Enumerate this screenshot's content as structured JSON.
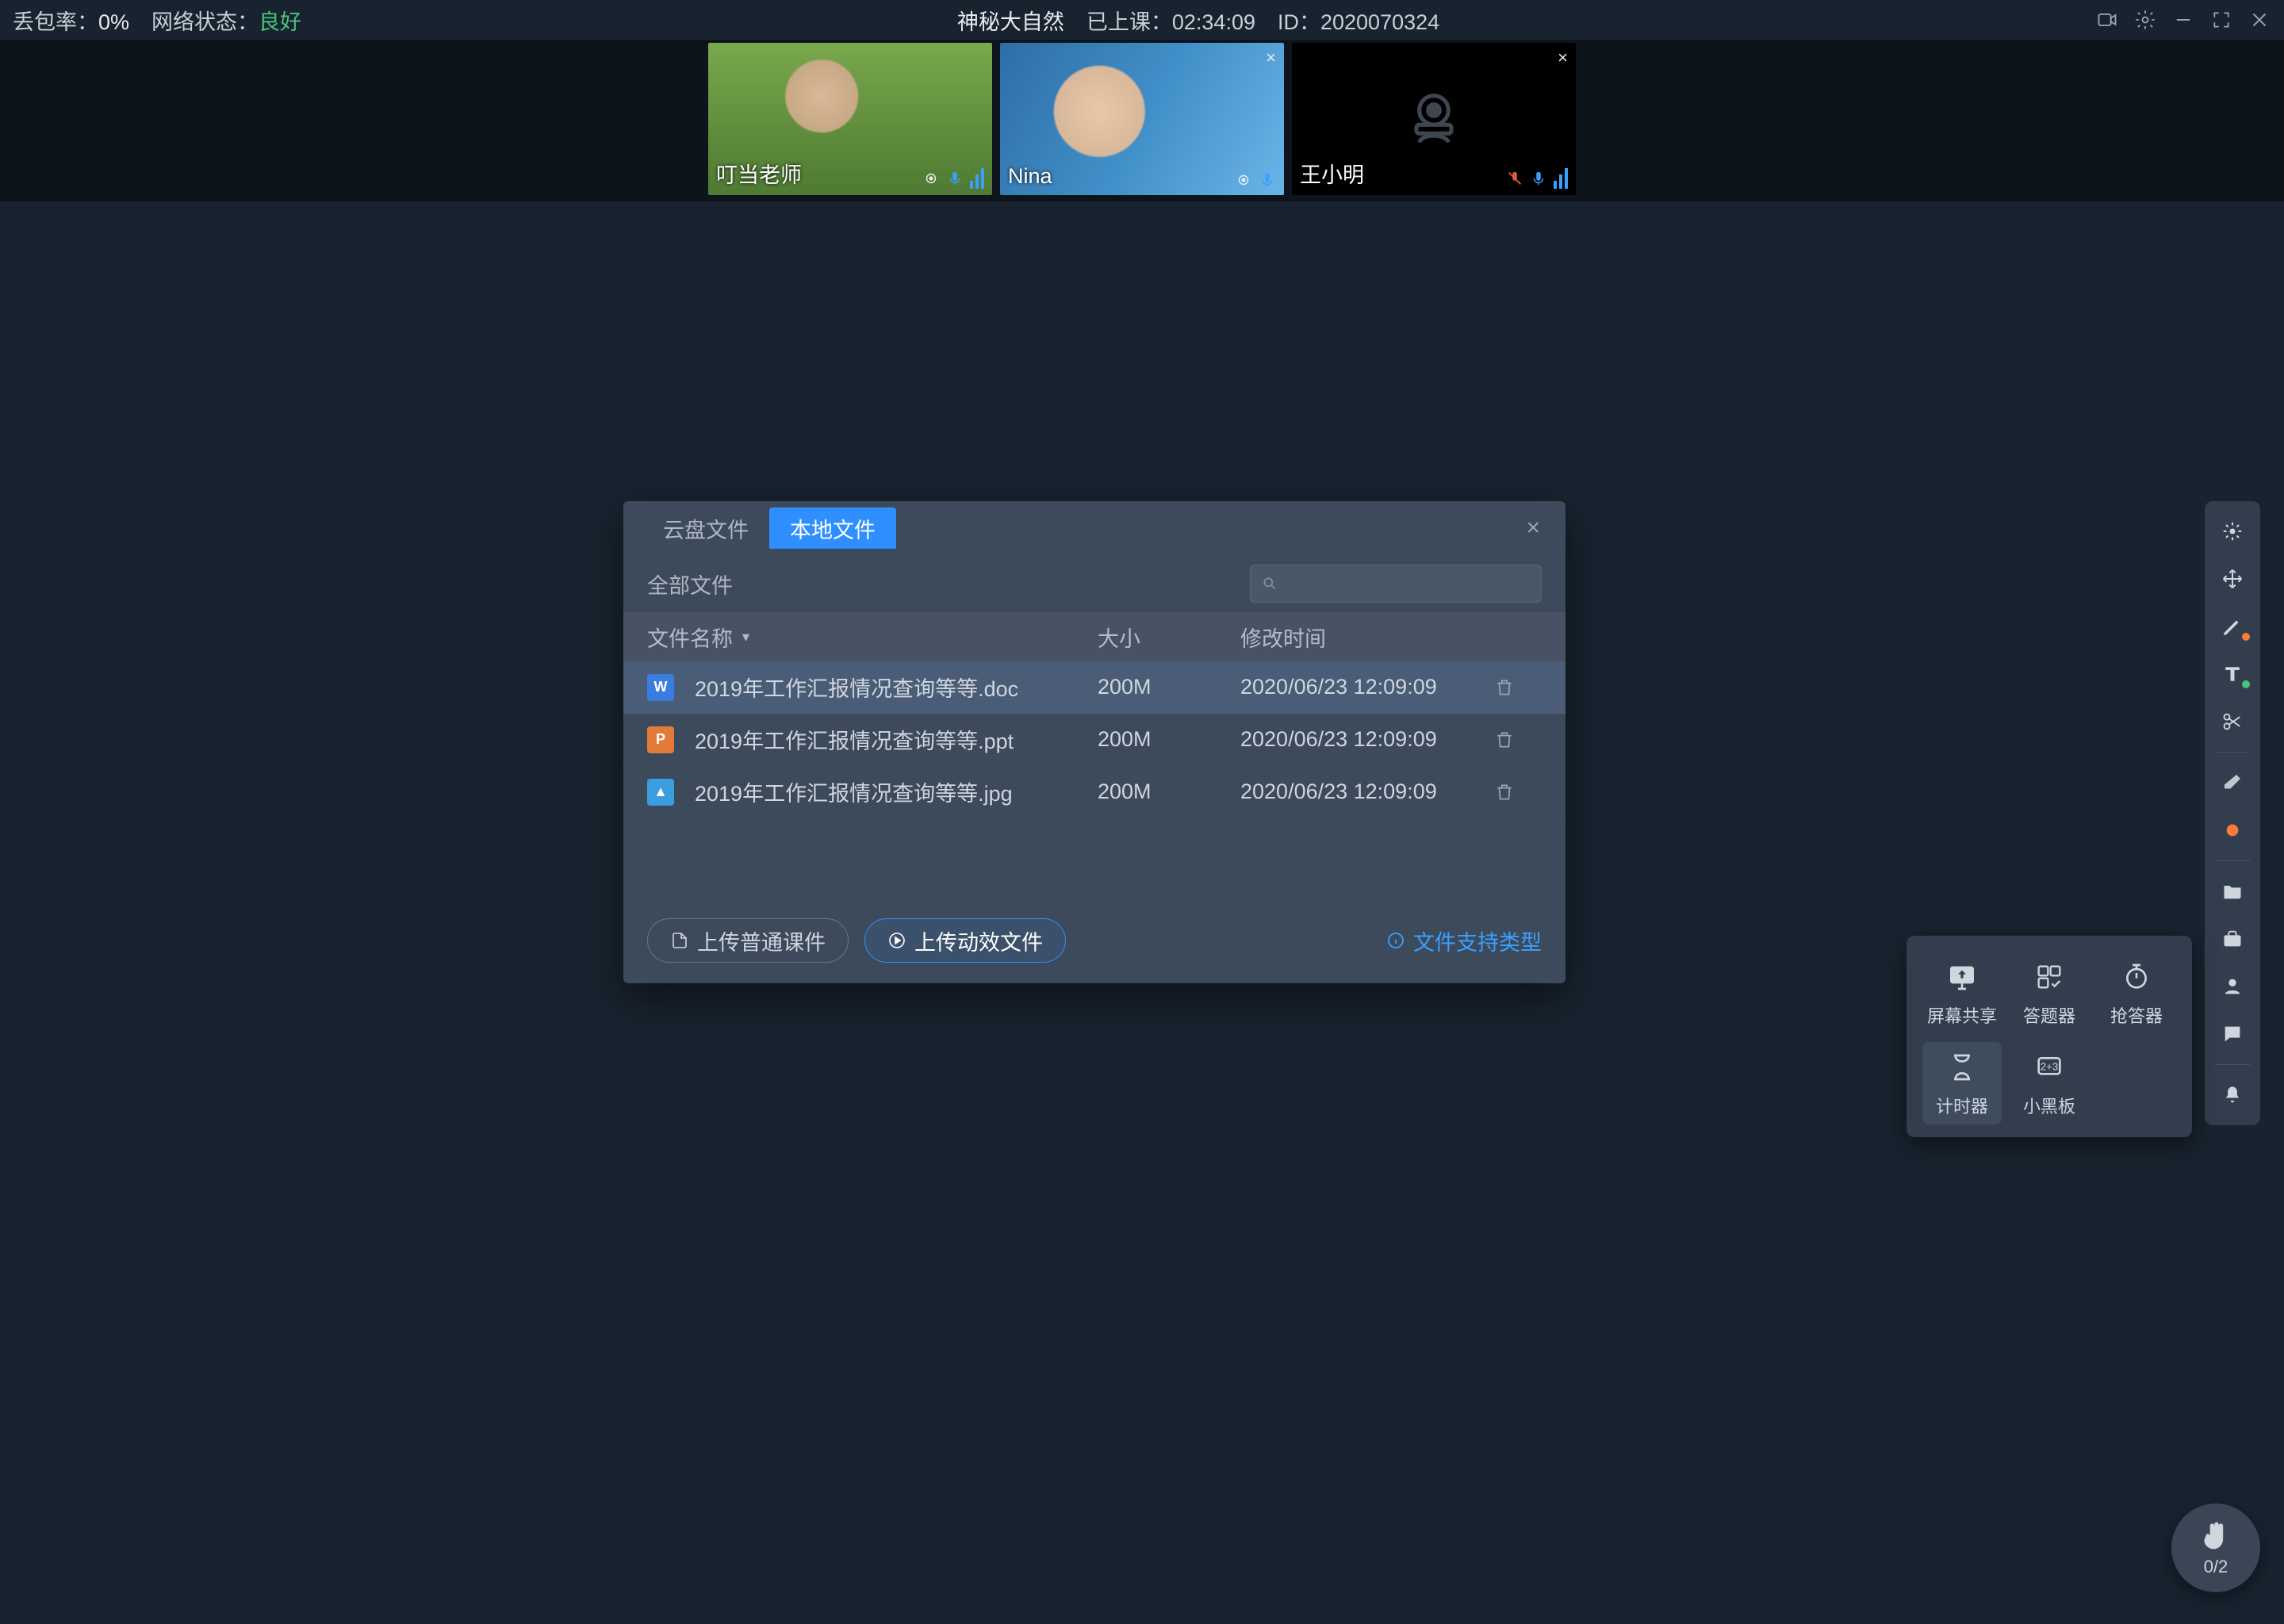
{
  "header": {
    "packetLossLabel": "丢包率：",
    "packetLossValue": "0%",
    "netLabel": "网络状态：",
    "netValue": "良好",
    "title": "神秘大自然",
    "elapsedLabel": "已上课：",
    "elapsedValue": "02:34:09",
    "idLabel": "ID：",
    "idValue": "2020070324"
  },
  "participants": [
    {
      "name": "叮当老师",
      "hasClose": false,
      "cameraOff": false,
      "micMuted": false
    },
    {
      "name": "Nina",
      "hasClose": true,
      "cameraOff": false,
      "micMuted": false
    },
    {
      "name": "王小明",
      "hasClose": true,
      "cameraOff": true,
      "micMuted": true
    }
  ],
  "dialog": {
    "tabs": {
      "cloud": "云盘文件",
      "local": "本地文件"
    },
    "breadcrumb": "全部文件",
    "searchPlaceholder": "",
    "columns": {
      "name": "文件名称",
      "size": "大小",
      "time": "修改时间"
    },
    "files": [
      {
        "icon": "doc",
        "name": "2019年工作汇报情况查询等等.doc",
        "size": "200M",
        "time": "2020/06/23 12:09:09"
      },
      {
        "icon": "ppt",
        "name": "2019年工作汇报情况查询等等.ppt",
        "size": "200M",
        "time": "2020/06/23 12:09:09"
      },
      {
        "icon": "img",
        "name": "2019年工作汇报情况查询等等.jpg",
        "size": "200M",
        "time": "2020/06/23 12:09:09"
      }
    ],
    "buttons": {
      "uploadNormal": "上传普通课件",
      "uploadAnim": "上传动效文件",
      "supported": "文件支持类型"
    }
  },
  "toolPopup": {
    "items": [
      {
        "key": "screenShare",
        "label": "屏幕共享"
      },
      {
        "key": "answerCard",
        "label": "答题器"
      },
      {
        "key": "responder",
        "label": "抢答器"
      },
      {
        "key": "timer",
        "label": "计时器"
      },
      {
        "key": "smallBoard",
        "label": "小黑板"
      }
    ]
  },
  "handBubble": {
    "count": "0/2"
  }
}
